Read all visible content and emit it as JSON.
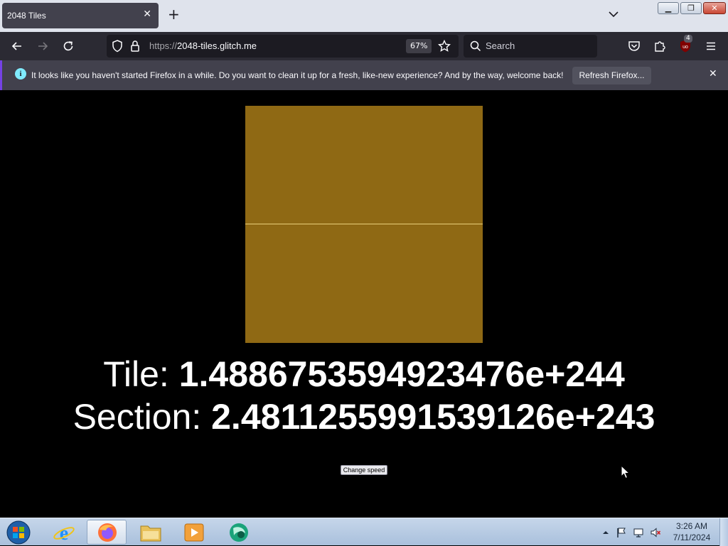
{
  "browser": {
    "tab": {
      "title": "2048 Tiles",
      "close_icon": "close-icon"
    },
    "new_tab_label": "+",
    "url": {
      "protocol": "https://",
      "host": "2048-tiles.glitch.me"
    },
    "zoom": "67%",
    "search_placeholder": "Search",
    "extension_badge": "4"
  },
  "notification": {
    "message": "It looks like you haven't started Firefox in a while. Do you want to clean it up for a fresh, like-new experience? And by the way, welcome back!",
    "button_label": "Refresh Firefox...",
    "info_glyph": "i"
  },
  "game": {
    "tile_label": "Tile: ",
    "tile_value": "1.4886753594923476e+244",
    "section_label": "Section: ",
    "section_value": "2.4811255991539126e+243",
    "change_speed_label": "Change speed",
    "tile_color": "#8f6914",
    "divider_color": "#e9cf7a"
  },
  "taskbar": {
    "time": "3:26 AM",
    "date": "7/11/2024",
    "pinned": [
      "internet-explorer-icon",
      "firefox-icon",
      "file-explorer-icon",
      "media-player-icon",
      "app-icon"
    ]
  }
}
